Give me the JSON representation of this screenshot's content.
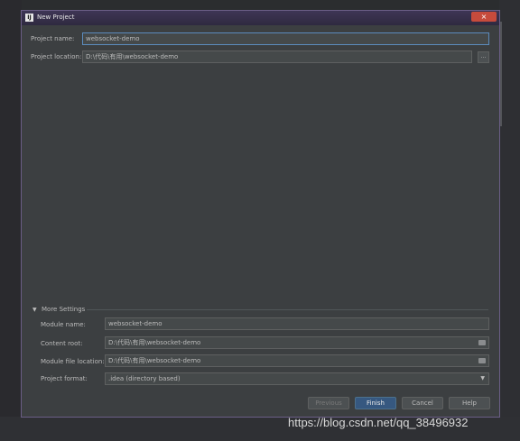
{
  "window": {
    "title": "New Project",
    "close_label": "×"
  },
  "project": {
    "name_label": "Project name:",
    "name_value": "websocket-demo",
    "location_label": "Project location:",
    "location_value": "D:\\代码\\有用\\websocket-demo",
    "browse_label": "..."
  },
  "more_settings": {
    "toggle_label": "More Settings",
    "module_name_label": "Module name:",
    "module_name_value": "websocket-demo",
    "content_root_label": "Content root:",
    "content_root_value": "D:\\代码\\有用\\websocket-demo",
    "module_file_label": "Module file location:",
    "module_file_value": "D:\\代码\\有用\\websocket-demo",
    "project_format_label": "Project format:",
    "project_format_value": ".idea (directory based)"
  },
  "buttons": {
    "previous": "Previous",
    "finish": "Finish",
    "cancel": "Cancel",
    "help": "Help"
  },
  "watermark": "https://blog.csdn.net/qq_38496932",
  "colors": {
    "accent": "#365880",
    "focus_border": "#5b8bbd",
    "close": "#c74b3c"
  }
}
